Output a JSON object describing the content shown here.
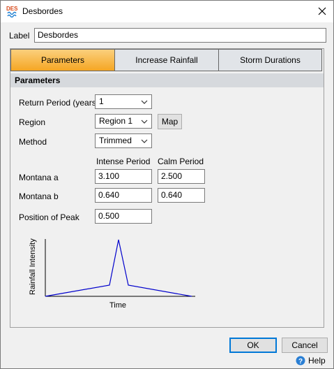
{
  "window": {
    "title": "Desbordes",
    "app_icon": "des-app-icon",
    "close_icon": "close-icon"
  },
  "label_field": {
    "label": "Label",
    "value": "Desbordes"
  },
  "tabs": [
    {
      "label": "Parameters",
      "active": true
    },
    {
      "label": "Increase Rainfall",
      "active": false
    },
    {
      "label": "Storm Durations",
      "active": false
    }
  ],
  "section": {
    "header": "Parameters"
  },
  "fields": {
    "return_period": {
      "label": "Return Period (years)",
      "value": "1"
    },
    "region": {
      "label": "Region",
      "value": "Region 1",
      "map_button": "Map"
    },
    "method": {
      "label": "Method",
      "value": "Trimmed"
    },
    "col_headers": {
      "intense": "Intense Period",
      "calm": "Calm Period"
    },
    "montana_a": {
      "label": "Montana a",
      "intense": "3.100",
      "calm": "2.500"
    },
    "montana_b": {
      "label": "Montana b",
      "intense": "0.640",
      "calm": "0.640"
    },
    "peak": {
      "label": "Position of Peak",
      "value": "0.500"
    }
  },
  "graph": {
    "ylabel": "Rainfall Intensity",
    "xlabel": "Time",
    "line_color": "#0000cc"
  },
  "footer": {
    "ok": "OK",
    "cancel": "Cancel",
    "help": "Help"
  }
}
